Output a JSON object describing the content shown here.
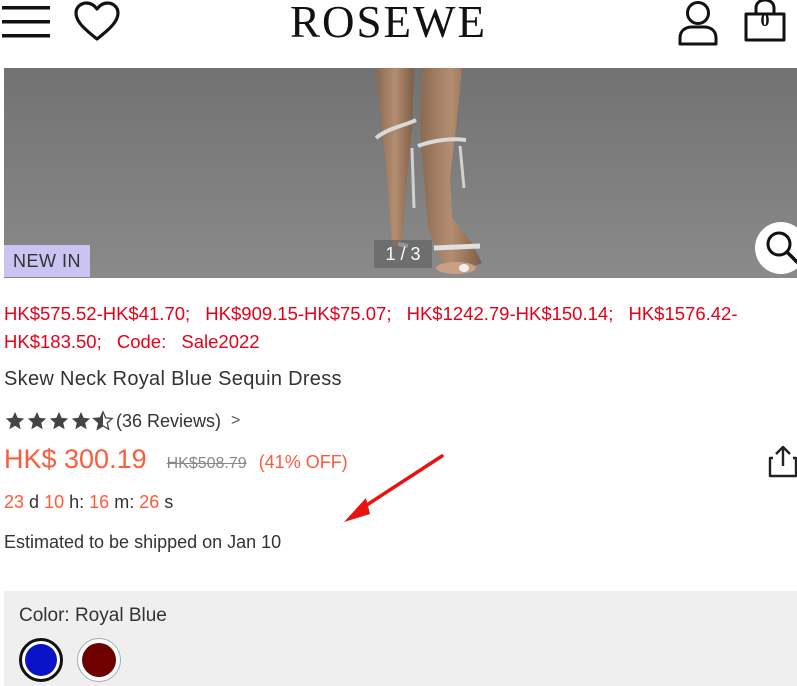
{
  "header": {
    "logo": "ROSEWE",
    "cart_count": "0",
    "icons": [
      "menu-icon",
      "heart-icon",
      "user-icon",
      "bag-icon"
    ]
  },
  "gallery": {
    "badge": "NEW IN",
    "pager": "1 / 3",
    "zoom_icon": "search-icon"
  },
  "promo": {
    "items": [
      "HK$575.52-HK$41.70;",
      "HK$909.15-HK$75.07;",
      "HK$1242.79-HK$150.14;",
      "HK$1576.42-HK$183.50;",
      "Code:",
      "Sale2022"
    ],
    "color": "#e6001a"
  },
  "product": {
    "title": "Skew Neck Royal Blue Sequin Dress",
    "rating": 4.5,
    "reviews": "(36 Reviews)",
    "reviews_arrow": ">",
    "price": "HK$ 300.19",
    "old_price": "HK$508.79",
    "discount": "(41% OFF)",
    "share_icon": "share-icon"
  },
  "countdown": {
    "days": "23",
    "d": "d",
    "hours": "10",
    "h": "h:",
    "minutes": "16",
    "m": "m:",
    "seconds": "26",
    "s": "s"
  },
  "shipping": {
    "text": "Estimated to be shipped on Jan 10"
  },
  "color": {
    "label": "Color: Royal Blue",
    "options": [
      {
        "name": "Royal Blue",
        "hex": "#0a12c6",
        "selected": true
      },
      {
        "name": "Burgundy",
        "hex": "#6e0000",
        "selected": false
      }
    ]
  },
  "colors": {
    "accent_price": "#ff5a3c",
    "badge_bg": "#c9c4f2"
  }
}
